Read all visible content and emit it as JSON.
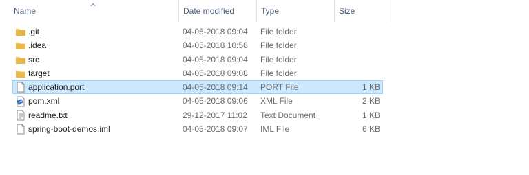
{
  "columns": {
    "name": "Name",
    "date_modified": "Date modified",
    "type": "Type",
    "size": "Size"
  },
  "files": [
    {
      "name": ".git",
      "date": "04-05-2018 09:04",
      "type": "File folder",
      "size": "",
      "icon": "folder-icon"
    },
    {
      "name": ".idea",
      "date": "04-05-2018 10:58",
      "type": "File folder",
      "size": "",
      "icon": "folder-icon"
    },
    {
      "name": "src",
      "date": "04-05-2018 09:04",
      "type": "File folder",
      "size": "",
      "icon": "folder-icon"
    },
    {
      "name": "target",
      "date": "04-05-2018 09:08",
      "type": "File folder",
      "size": "",
      "icon": "folder-icon"
    },
    {
      "name": "application.port",
      "date": "04-05-2018 09:14",
      "type": "PORT File",
      "size": "1 KB",
      "icon": "file-icon",
      "selected": true
    },
    {
      "name": "pom.xml",
      "date": "04-05-2018 09:06",
      "type": "XML File",
      "size": "2 KB",
      "icon": "xml-file-icon"
    },
    {
      "name": "readme.txt",
      "date": "29-12-2017 11:02",
      "type": "Text Document",
      "size": "1 KB",
      "icon": "text-file-icon"
    },
    {
      "name": "spring-boot-demos.iml",
      "date": "04-05-2018 09:07",
      "type": "IML File",
      "size": "6 KB",
      "icon": "file-icon"
    }
  ],
  "colors": {
    "selection_bg": "#cce8ff",
    "selection_border": "#99d1ff",
    "folder": "#e8b84a",
    "header_text": "#4c607a"
  }
}
